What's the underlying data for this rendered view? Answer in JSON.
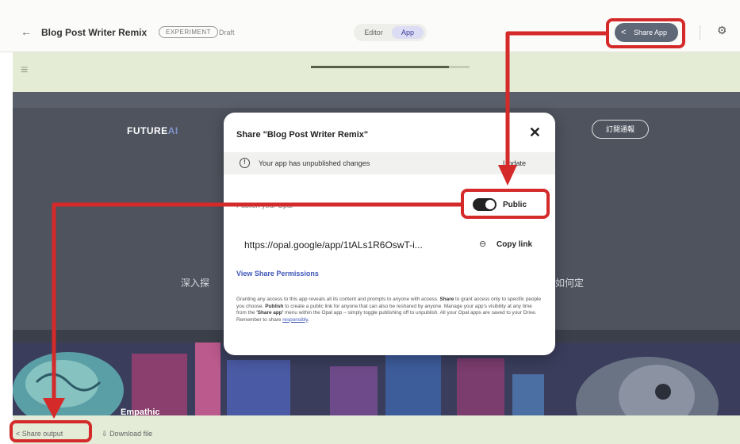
{
  "header": {
    "back_icon": "back-arrow-icon",
    "app_title": "Blog Post Writer Remix",
    "experiment_badge": "EXPERIMENT",
    "draft_label": "Draft",
    "tabs": [
      {
        "label": "Editor",
        "active": false
      },
      {
        "label": "App",
        "active": true
      }
    ],
    "share_app_label": "Share App",
    "settings_icon": "gear-icon"
  },
  "progress": {
    "fraction": 0.87
  },
  "app_canvas": {
    "brand_main": "FUTURE",
    "brand_accent": "AI",
    "header_button": "訂閱通報",
    "bg_text_left": "深入探",
    "bg_text_right": "如何定",
    "hero_caption": "Empathic"
  },
  "dialog": {
    "title": "Share \"Blog Post Writer Remix\"",
    "notice": "Your app has unpublished changes",
    "update_label": "Update",
    "publish_label": "Publish your Opal",
    "visibility_label": "Public",
    "visibility_on": true,
    "share_url": "https://opal.google/app/1tALs1R6OswT-i...",
    "copy_link_label": "Copy link",
    "view_permissions_label": "View Share Permissions",
    "disclaimer_p1": "Granting any access to this app reveals all its content and prompts to anyone with access.",
    "disclaimer_share": "Share",
    "disclaimer_p2": "to grant access only to specific people you choose.",
    "disclaimer_publish": "Publish",
    "disclaimer_p3": "to create a public link for anyone that can also be reshared by anyone. Manage your app's visibility at any time from the",
    "disclaimer_share_app": "'Share app'",
    "disclaimer_p4": "menu within the Opal app – simply toggle publishing off to unpublish. All your Opal apps are saved to your Drive. Remember to share",
    "disclaimer_link": "responsibly"
  },
  "footer": {
    "share_output_label": "Share output",
    "download_file_label": "Download file"
  },
  "annotation_color": "#d42a2a"
}
